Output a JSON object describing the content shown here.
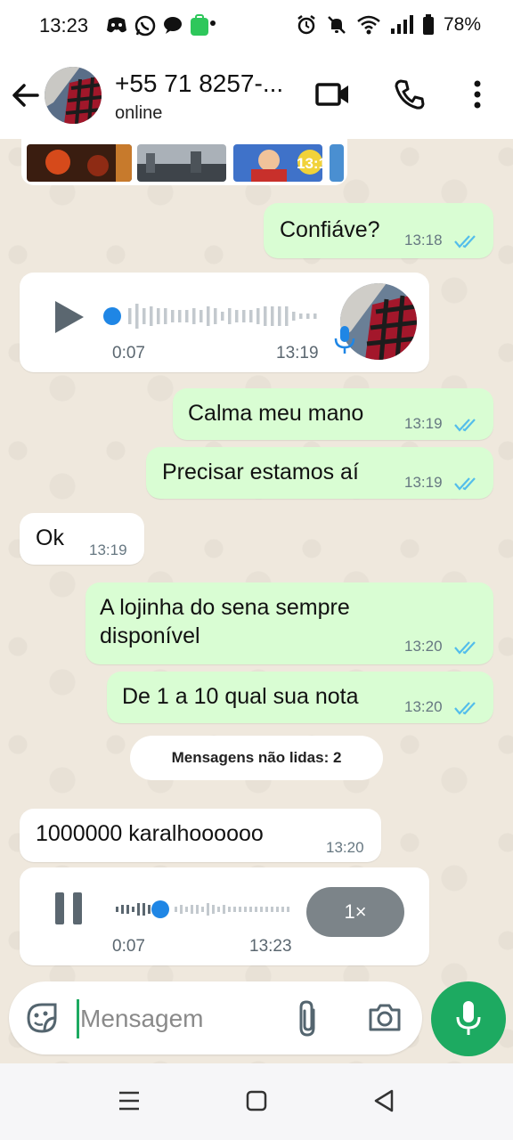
{
  "status_bar": {
    "time": "13:23",
    "battery": "78%"
  },
  "header": {
    "contact_name": "+55 71 8257-...",
    "contact_status": "online"
  },
  "messages": [
    {
      "text": "Confiáve?",
      "time": "13:18"
    },
    {
      "duration": "0:07",
      "time": "13:19"
    },
    {
      "text": "Calma meu mano",
      "time": "13:19"
    },
    {
      "text": "Precisar estamos aí",
      "time": "13:19"
    },
    {
      "text": "Ok",
      "time": "13:19"
    },
    {
      "text_line1": "A lojinha do sena sempre",
      "text_line2": "disponível",
      "time": "13:20"
    },
    {
      "text": "De 1 a 10 qual sua nota",
      "time": "13:20"
    },
    {
      "text": "1000000 karalhoooooo",
      "time": "13:20"
    },
    {
      "duration": "0:07",
      "time": "13:23",
      "speed": "1×"
    }
  ],
  "unread_badge": "Mensagens não lidas: 2",
  "media_strip": {
    "overlay": "13:18"
  },
  "compose": {
    "placeholder": "Mensagem"
  },
  "colors": {
    "outgoing_bubble": "#d9fdd3",
    "incoming_bubble": "#ffffff",
    "accent_green": "#1daa61",
    "read_ticks": "#53bdeb"
  },
  "icons": [
    "back-arrow-icon",
    "video-call-icon",
    "phone-icon",
    "more-vert-icon",
    "play-icon",
    "pause-icon",
    "mic-icon",
    "sticker-icon",
    "attach-icon",
    "camera-icon"
  ]
}
